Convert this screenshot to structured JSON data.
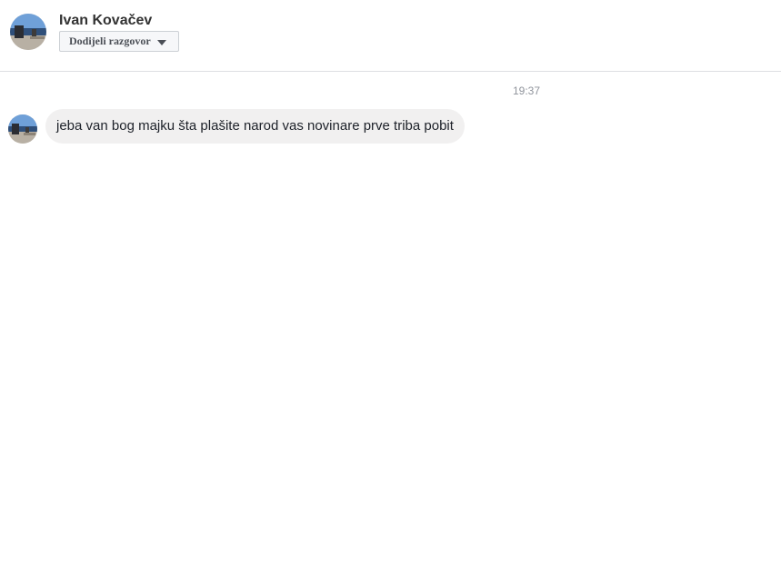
{
  "header": {
    "contact_name": "Ivan Kovačev",
    "assign_button_label": "Dodijeli razgovor",
    "assign_button_icon": "caret-down-icon"
  },
  "messages": [
    {
      "time": "19:37",
      "sender": "Ivan Kovačev",
      "text": "jeba van bog majku šta plašite narod vas novinare prve triba pobit"
    }
  ],
  "colors": {
    "bubble_background": "#f1f0f0",
    "divider": "#dddfe2",
    "timestamp_text": "#90949c"
  }
}
